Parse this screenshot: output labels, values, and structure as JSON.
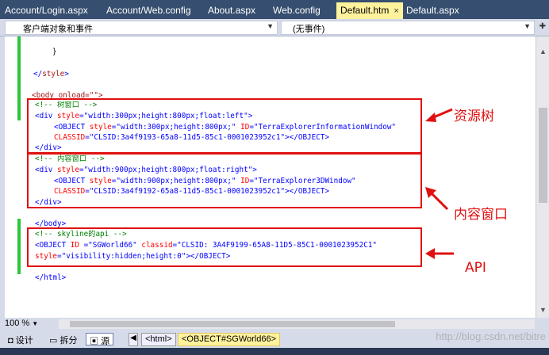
{
  "tabs": [
    {
      "label": "Account/Login.aspx"
    },
    {
      "label": "Account/Web.config"
    },
    {
      "label": "About.aspx"
    },
    {
      "label": "Web.config"
    },
    {
      "label": "Default.htm",
      "close": "×"
    },
    {
      "label": "Default.aspx"
    }
  ],
  "navbar": {
    "left_combo": "客户端对象和事件",
    "right_combo": "(无事件)"
  },
  "code": {
    "l1": "}",
    "l2_a": "</",
    "l2_b": "style",
    "l2_c": ">",
    "l3": "<body onload=\"\">",
    "l4": "<!-- 树窗口 -->",
    "l5_a": "<div ",
    "l5_b": "style",
    "l5_c": "=\"width:300px;height:800px;float:left\">",
    "l6_a": "<OBJECT ",
    "l6_b": "style",
    "l6_c": "=\"width:300px;height:800px;\" ",
    "l6_d": "ID",
    "l6_e": "=\"TerraExplorerInformationWindow\"",
    "l7_a": "CLASSID",
    "l7_b": "=\"CLSID:3a4f9193-65a8-11d5-85c1-0001023952c1\"></OBJECT>",
    "l8": "</div>",
    "l9": "<!-- 内容窗口 -->",
    "l10_a": "<div ",
    "l10_b": "style",
    "l10_c": "=\"width:900px;height:800px;float:right\">",
    "l11_a": "<OBJECT ",
    "l11_b": "style",
    "l11_c": "=\"width:900px;height:800px;\" ",
    "l11_d": "ID",
    "l11_e": "=\"TerraExplorer3DWindow\"",
    "l12_a": "CLASSID",
    "l12_b": "=\"CLSID:3a4f9192-65a8-11d5-85c1-0001023952c1\"></OBJECT>",
    "l13": "</div>",
    "l14": "</body>",
    "l15": "<!-- skyline的api -->",
    "l16_a": "<OBJECT ",
    "l16_b": "ID",
    "l16_c": " =\"SGWorld66\" ",
    "l16_d": "classid",
    "l16_e": "=\"CLSID: 3A4F9199-65A8-11D5-85C1-0001023952C1\"",
    "l17_a": "style",
    "l17_b": "=\"visibility:hidden;height:0\"></OBJECT>",
    "l18": "</html>"
  },
  "annotations": {
    "tree": "资源树",
    "content": "内容窗口",
    "api": "API"
  },
  "zoom": "100 %",
  "status": {
    "design": "设计",
    "split": "拆分",
    "source": "源",
    "crumb1": "<html>",
    "crumb2": "<OBJECT#SGWorld66>"
  },
  "watermark": "http://blog.csdn.net/bitre"
}
